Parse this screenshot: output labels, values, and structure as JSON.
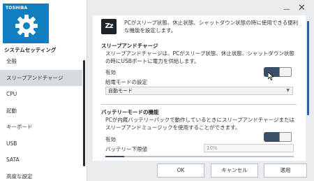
{
  "sidebar": {
    "brand": "TOSHIBA",
    "app_title": "システムセッティング",
    "items": [
      {
        "label": "全般"
      },
      {
        "label": "スリープアンドチャージ"
      },
      {
        "label": "CPU"
      },
      {
        "label": "起動"
      },
      {
        "label": "キーボード"
      },
      {
        "label": "USB"
      },
      {
        "label": "SATA"
      },
      {
        "label": "高度な設定"
      }
    ],
    "active_index": 1
  },
  "window": {
    "minimize_glyph": "—",
    "close_glyph": "✕"
  },
  "main": {
    "header_icon_text": "Zz",
    "intro": "PCがスリープ状態、休止状態、シャットダウン状態の時に使用できる便利な機能を設定します。",
    "sleep_charge": {
      "title": "スリープアンドチャージ",
      "description": "スリープアンドチャージは、PCがスリープ状態、休止状態、シャットダウン状態の時にUSBポートに電力を供給します。",
      "enabled_label": "有効",
      "enabled": true,
      "mode_label": "給電モードの設定",
      "mode_value": "自動モード"
    },
    "battery_mode": {
      "title": "バッテリーモードの機能",
      "description": "PCが内蔵バッテリーパックで動作しているときにスリープアンドチャージまたはスリープアンドミュージックを使用することができます。",
      "enabled_label": "有効",
      "enabled": true,
      "lower_limit_label": "バッテリー下限値",
      "lower_limit_value": "10%",
      "slider_fraction": 0.1
    }
  },
  "buttons": {
    "ok": "OK",
    "cancel": "キャンセル",
    "apply": "適用"
  },
  "colors": {
    "brand_blue": "#0f7fc0",
    "toggle_on": "#3a4f66",
    "scroll_thumb": "#2f5ea8"
  }
}
